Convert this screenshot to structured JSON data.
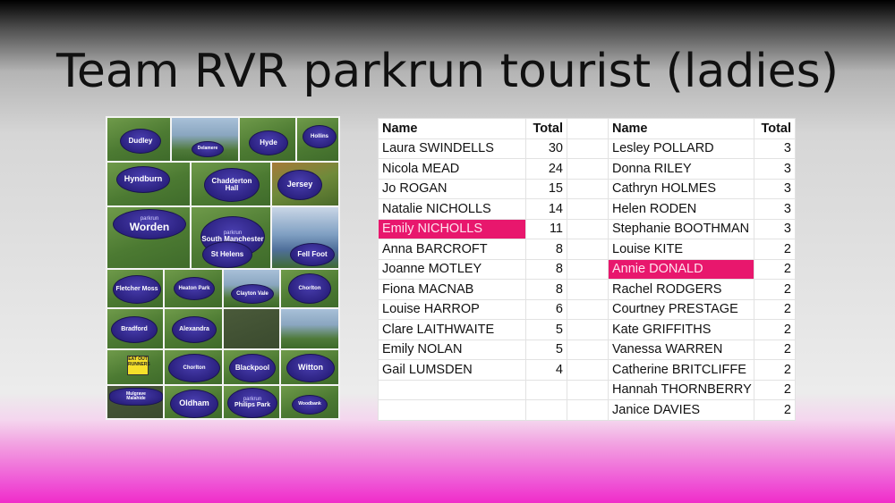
{
  "slide": {
    "title": "Team RVR parkrun tourist (ladies)"
  },
  "collage": {
    "signs": [
      "Dudley",
      "Delamere",
      "Hyde",
      "Hollins",
      "Hyndburn",
      "Chadderton Hall",
      "Jersey",
      "Worden",
      "South Manchester",
      "Fell Foot",
      "St Helens",
      "Fletcher Moss",
      "Heaton Park",
      "Clayton Vale",
      "Chorlton",
      "Bradford",
      "Alexandra",
      "Witton",
      "Blackpool",
      "Oldham",
      "Philips Park",
      "Mulgrave",
      "Woodbank",
      "Malahide"
    ],
    "brand": "parkrun",
    "yellow_sign": "EAT OUT RUNNERS"
  },
  "table": {
    "headers": {
      "name": "Name",
      "total": "Total"
    },
    "left": [
      {
        "name": "Laura SWINDELLS",
        "total": "30",
        "highlight": false
      },
      {
        "name": "Nicola MEAD",
        "total": "24",
        "highlight": false
      },
      {
        "name": "Jo ROGAN",
        "total": "15",
        "highlight": false
      },
      {
        "name": "Natalie NICHOLLS",
        "total": "14",
        "highlight": false
      },
      {
        "name": "Emily NICHOLLS",
        "total": "11",
        "highlight": true
      },
      {
        "name": "Anna BARCROFT",
        "total": "8",
        "highlight": false
      },
      {
        "name": "Joanne MOTLEY",
        "total": "8",
        "highlight": false
      },
      {
        "name": "Fiona MACNAB",
        "total": "8",
        "highlight": false
      },
      {
        "name": "Louise HARROP",
        "total": "6",
        "highlight": false
      },
      {
        "name": "Clare LAITHWAITE",
        "total": "5",
        "highlight": false
      },
      {
        "name": "Emily NOLAN",
        "total": "5",
        "highlight": false
      },
      {
        "name": "Gail LUMSDEN",
        "total": "4",
        "highlight": false
      },
      {
        "name": "",
        "total": "",
        "highlight": false
      },
      {
        "name": "",
        "total": "",
        "highlight": false
      }
    ],
    "right": [
      {
        "name": "Lesley POLLARD",
        "total": "3",
        "highlight": false
      },
      {
        "name": "Donna RILEY",
        "total": "3",
        "highlight": false
      },
      {
        "name": "Cathryn HOLMES",
        "total": "3",
        "highlight": false
      },
      {
        "name": "Helen RODEN",
        "total": "3",
        "highlight": false
      },
      {
        "name": "Stephanie BOOTHMAN",
        "total": "3",
        "highlight": false
      },
      {
        "name": "Louise KITE",
        "total": "2",
        "highlight": false
      },
      {
        "name": "Annie DONALD",
        "total": "2",
        "highlight": true
      },
      {
        "name": "Rachel RODGERS",
        "total": "2",
        "highlight": false
      },
      {
        "name": "Courtney PRESTAGE",
        "total": "2",
        "highlight": false
      },
      {
        "name": "Kate GRIFFITHS",
        "total": "2",
        "highlight": false
      },
      {
        "name": "Vanessa WARREN",
        "total": "2",
        "highlight": false
      },
      {
        "name": "Catherine BRITCLIFFE",
        "total": "2",
        "highlight": false
      },
      {
        "name": "Hannah THORNBERRY",
        "total": "2",
        "highlight": false
      },
      {
        "name": "Janice DAVIES",
        "total": "2",
        "highlight": false
      }
    ],
    "highlight_color": "#e8176d"
  }
}
